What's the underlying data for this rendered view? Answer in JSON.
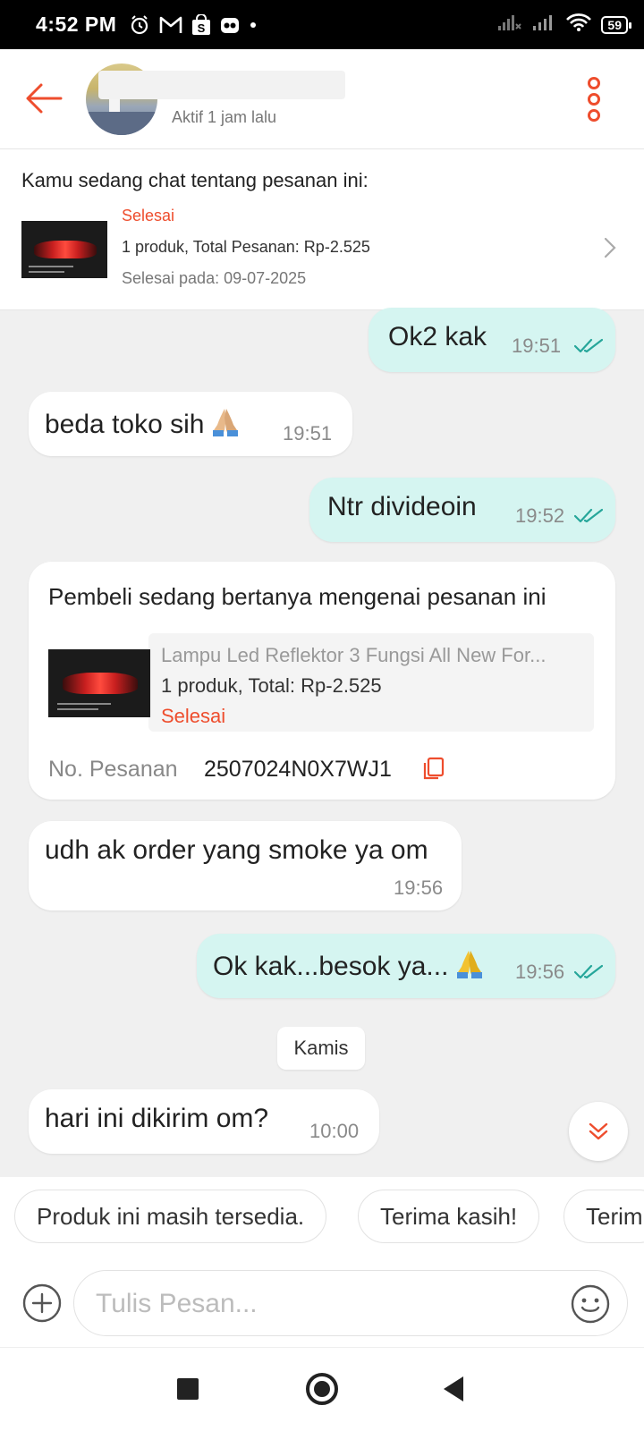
{
  "status_bar": {
    "time": "4:52 PM",
    "battery": "59",
    "icons": [
      "alarm-icon",
      "gmail-icon",
      "shopee-icon",
      "app-icon",
      "dot-icon",
      "signal-icon",
      "wifi-icon",
      "battery-icon"
    ]
  },
  "header": {
    "status": "Aktif 1 jam lalu"
  },
  "order_summary": {
    "heading": "Kamu sedang chat tentang pesanan ini:",
    "status": "Selesai",
    "line1": "1 produk, Total Pesanan: Rp-2.525",
    "line2": "Selesai pada: 09-07-2025"
  },
  "messages": [
    {
      "id": "m1",
      "direction": "outgoing",
      "text": "Ok2 kak",
      "time": "19:51",
      "read": true
    },
    {
      "id": "m2",
      "direction": "incoming",
      "text": "beda toko sih",
      "emoji": "folded-hands",
      "time": "19:51"
    },
    {
      "id": "m3",
      "direction": "outgoing",
      "text": "Ntr divideoin",
      "time": "19:52",
      "read": true
    },
    {
      "id": "m5",
      "direction": "incoming",
      "text": "udh ak order yang smoke ya om",
      "time": "19:56"
    },
    {
      "id": "m6",
      "direction": "outgoing",
      "text": "Ok kak...besok ya...",
      "emoji": "folded-hands",
      "time": "19:56",
      "read": true
    },
    {
      "id": "m7",
      "direction": "incoming",
      "text": "hari ini dikirim om?",
      "time": "10:00"
    }
  ],
  "product_card": {
    "heading": "Pembeli sedang bertanya mengenai pesanan ini",
    "product_name": "Lampu Led Reflektor 3 Fungsi All New For...",
    "total": "1 produk, Total: Rp-2.525",
    "status": "Selesai",
    "order_label": "No. Pesanan",
    "order_number": "2507024N0X7WJ1"
  },
  "date_separator": "Kamis",
  "quick_replies": [
    "Produk ini masih tersedia.",
    "Terima kasih!",
    "Terim"
  ],
  "composer": {
    "placeholder": "Tulis Pesan..."
  },
  "colors": {
    "accent": "#ee4d2d",
    "outgoing_bubble": "#d5f5f1",
    "read_tick": "#26a69a",
    "chat_bg": "#f0f0f0"
  }
}
